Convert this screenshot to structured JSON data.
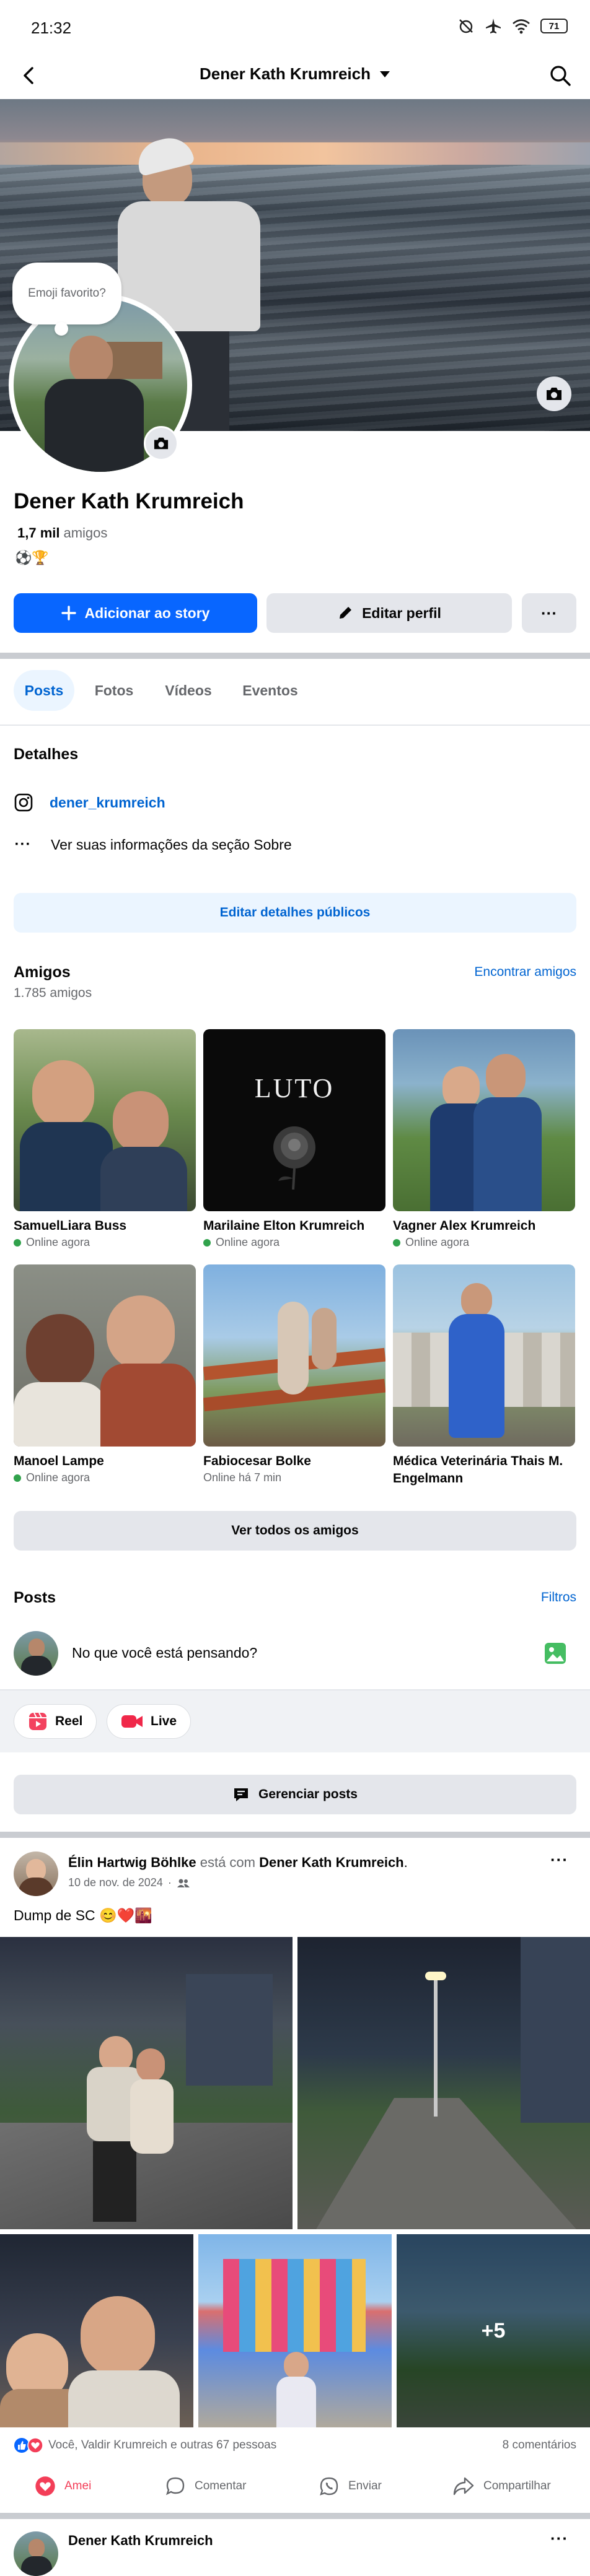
{
  "status": {
    "time": "21:32",
    "battery": "71"
  },
  "topbar": {
    "title": "Dener Kath Krumreich"
  },
  "profile": {
    "thought_bubble": "Emoji favorito?",
    "name": "Dener Kath Krumreich",
    "friends_count": "1,7 mil",
    "friends_word": "amigos",
    "emojis": "⚽🏆"
  },
  "actions": {
    "add_story": "Adicionar ao story",
    "edit_profile": "Editar perfil",
    "more": "···"
  },
  "tabs": [
    {
      "label": "Posts",
      "active": true
    },
    {
      "label": "Fotos",
      "active": false
    },
    {
      "label": "Vídeos",
      "active": false
    },
    {
      "label": "Eventos",
      "active": false
    }
  ],
  "details": {
    "heading": "Detalhes",
    "instagram": "dener_krumreich",
    "about": "Ver suas informações da seção Sobre",
    "edit_button": "Editar detalhes públicos"
  },
  "friends": {
    "heading": "Amigos",
    "count": "1.785 amigos",
    "find": "Encontrar amigos",
    "see_all": "Ver todos os amigos",
    "items": [
      {
        "name": "SamuelLiara Buss",
        "status": "Online agora",
        "online": true
      },
      {
        "name": "Marilaine Elton Krumreich",
        "status": "Online agora",
        "online": true
      },
      {
        "name": "Vagner Alex Krumreich",
        "status": "Online agora",
        "online": true
      },
      {
        "name": "Manoel Lampe",
        "status": "Online agora",
        "online": true
      },
      {
        "name": "Fabiocesar Bolke",
        "status": "Online há 7 min",
        "online": false
      },
      {
        "name": "Médica Veterinária Thais M. Engelmann",
        "status": "",
        "online": false
      }
    ],
    "luto_text": "LUTO"
  },
  "posts": {
    "heading": "Posts",
    "filters": "Filtros",
    "composer_placeholder": "No que você está pensando?",
    "reel": "Reel",
    "live": "Live",
    "manage": "Gerenciar posts"
  },
  "post": {
    "author": "Élin Hartwig Böhlke",
    "with_text": "está com",
    "tagged": "Dener Kath Krumreich",
    "date": "10 de nov. de 2024",
    "date_sep": "·",
    "caption": "Dump de SC 😊❤️🌇",
    "more_photos": "+5",
    "reactions": "Você, Valdir Krumreich e outras 67 pessoas",
    "comments": "8 comentários",
    "like": "Amei",
    "comment": "Comentar",
    "send": "Enviar",
    "share": "Compartilhar"
  },
  "next_post": {
    "author": "Dener Kath Krumreich"
  },
  "colors": {
    "accent": "#0866ff",
    "love": "#f33e58",
    "online": "#31a24c",
    "light_button": "#e4e6eb",
    "link": "#0064d1"
  }
}
